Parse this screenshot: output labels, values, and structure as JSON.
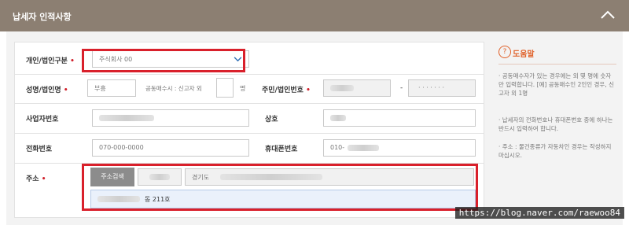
{
  "header": {
    "title": "납세자 인적사항"
  },
  "form": {
    "type_label": "개인/법인구분",
    "type_value": "주식회사 00",
    "name_label": "성명/법인명",
    "name_value": "부흥",
    "joint_prefix": "공동매수시 : 신고자 외",
    "joint_suffix": "명",
    "resident_label": "주민/법인번호",
    "resident_dash": "-",
    "resident_mask": "· · · · · · ·",
    "bizno_label": "사업자번호",
    "company_label": "상호",
    "phone_label": "전화번호",
    "phone_placeholder": "070-000-0000",
    "mobile_label": "휴대폰번호",
    "mobile_value": "010-",
    "address_label": "주소",
    "address_search": "주소검색",
    "address_province": "경기도",
    "address_detail": "동 211호"
  },
  "help": {
    "title": "도움말",
    "tips": [
      "· 공동매수자가 있는 경우에는 외 몇 명에 숫자만 입력합니다. [예] 공동매수인 2인인 경우, 신고자 외 1명",
      "· 납세자의 전화번호나 휴대폰번호 중에 하나는 반드시 입력하여 합니다.",
      "· 주소 : 물건종류가 자동차인 경우는 작성하지 마십시오."
    ]
  },
  "watermark": "https://blog.naver.com/raewoo84",
  "colors": {
    "header": "#8c7f72",
    "required": "#d0202b",
    "highlight": "#d9202b",
    "help_accent": "#e0612a",
    "link_blue": "#2f6fb6"
  }
}
